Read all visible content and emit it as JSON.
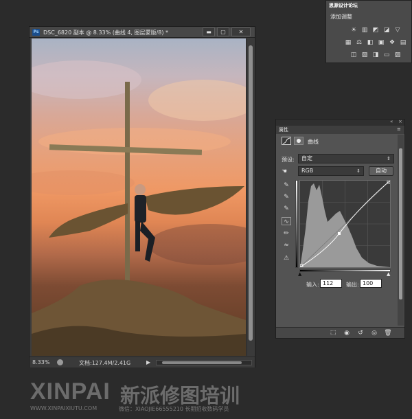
{
  "document": {
    "app_badge": "Ps",
    "title": "DSC_6820 副本 @ 8.33% (曲线 4, 图层蒙版/8) *",
    "window_buttons": {
      "minimize": "▬",
      "maximize": "▢",
      "close": "✕"
    },
    "zoom": "8.33%",
    "doc_size": "文档:127.4M/2.41G",
    "status_arrow": "▶"
  },
  "adjustments": {
    "tab_label": "思源设计论坛",
    "title": "添加调整",
    "icons": [
      "brightness-icon",
      "levels-icon",
      "curves-icon",
      "exposure-icon",
      "triangle-icon",
      "vibrance-icon",
      "balance-icon",
      "bw-icon",
      "photo-filter-icon",
      "mixer-icon",
      "lookup-icon",
      "invert-icon",
      "posterize-icon",
      "threshold-icon",
      "gradient-map-icon",
      "selective-color-icon"
    ]
  },
  "properties": {
    "collapse": "«",
    "close": "×",
    "tab_label": "属性",
    "menu": "≡",
    "name": "曲线",
    "preset_label": "预设:",
    "preset_value": "自定",
    "channel_value": "RGB",
    "auto_label": "自动",
    "input_label": "输入:",
    "input_value": "112",
    "output_label": "输出:",
    "output_value": "100"
  },
  "watermark": {
    "brand": "XINPAI",
    "brand_cn": "新派修图培训",
    "url": "WWW.XINPAIXIUTU.COM",
    "wechat": "微信：XIAOJIE66555210 长期招收数码学员"
  },
  "colors": {
    "panel": "#535353",
    "background": "#2b2b2b",
    "curve": "#ffffff"
  }
}
